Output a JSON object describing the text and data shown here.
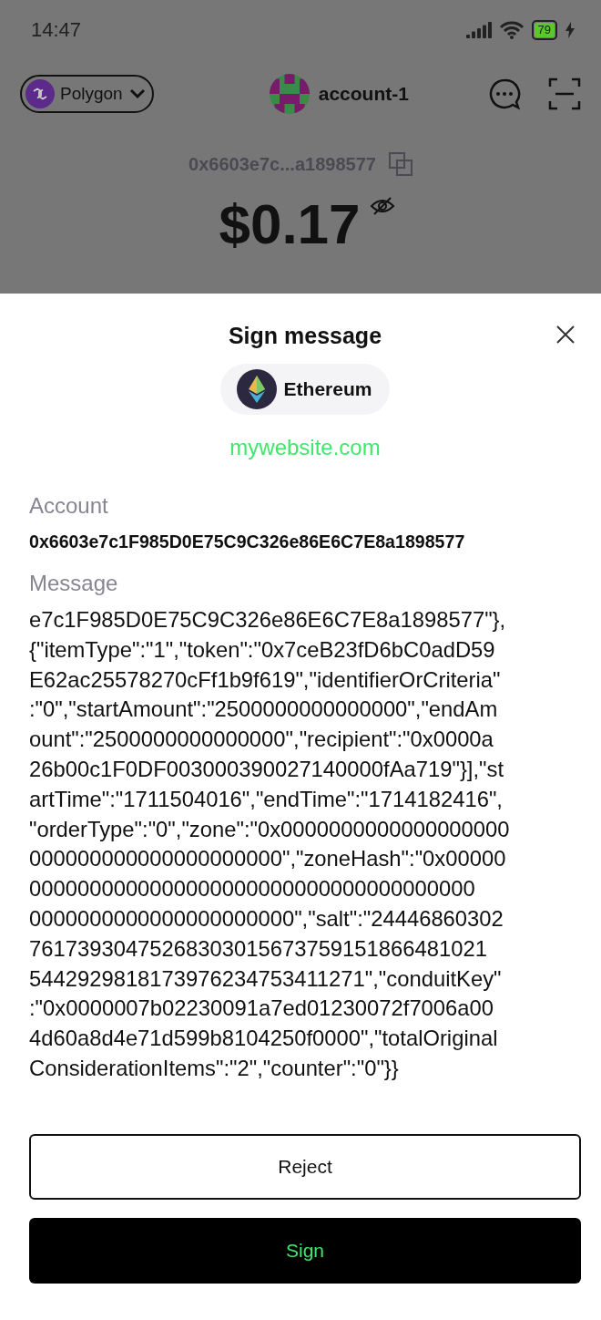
{
  "status_bar": {
    "time": "14:47",
    "battery": "79"
  },
  "header": {
    "network": "Polygon",
    "account": "account-1",
    "address": "0x6603e7c...a1898577",
    "balance": "$0.17"
  },
  "sheet": {
    "title": "Sign message",
    "chain": "Ethereum",
    "site": "mywebsite.com",
    "account_label": "Account",
    "account": "0x6603e7c1F985D0E75C9C326e86E6C7E8a1898577",
    "message_label": "Message",
    "message_lines": [
      "e7c1F985D0E75C9C326e86E6C7E8a1898577\"},",
      "{\"itemType\":\"1\",\"token\":\"0x7ceB23fD6bC0adD59",
      "E62ac25578270cFf1b9f619\",\"identifierOrCriteria\"",
      ":\"0\",\"startAmount\":\"2500000000000000\",\"endAm",
      "ount\":\"2500000000000000\",\"recipient\":\"0x0000a",
      "26b00c1F0DF003000390027140000fAa719\"}],\"st",
      "artTime\":\"1711504016\",\"endTime\":\"1714182416\",",
      "\"orderType\":\"0\",\"zone\":\"0x0000000000000000000",
      "000000000000000000000\",\"zoneHash\":\"0x00000",
      "0000000000000000000000000000000000000",
      "0000000000000000000000\",\"salt\":\"24446860302",
      "76173930475268303015673759151866481021",
      "5442929818173976234753411271\",\"conduitKey\"",
      ":\"0x0000007b02230091a7ed01230072f7006a00",
      "4d60a8d4e71d599b8104250f0000\",\"totalOriginal",
      "ConsiderationItems\":\"2\",\"counter\":\"0\"}}"
    ],
    "buttons": [
      {
        "label": "Reject",
        "kind": "outline"
      },
      {
        "label": "Sign",
        "kind": "primary"
      }
    ]
  }
}
